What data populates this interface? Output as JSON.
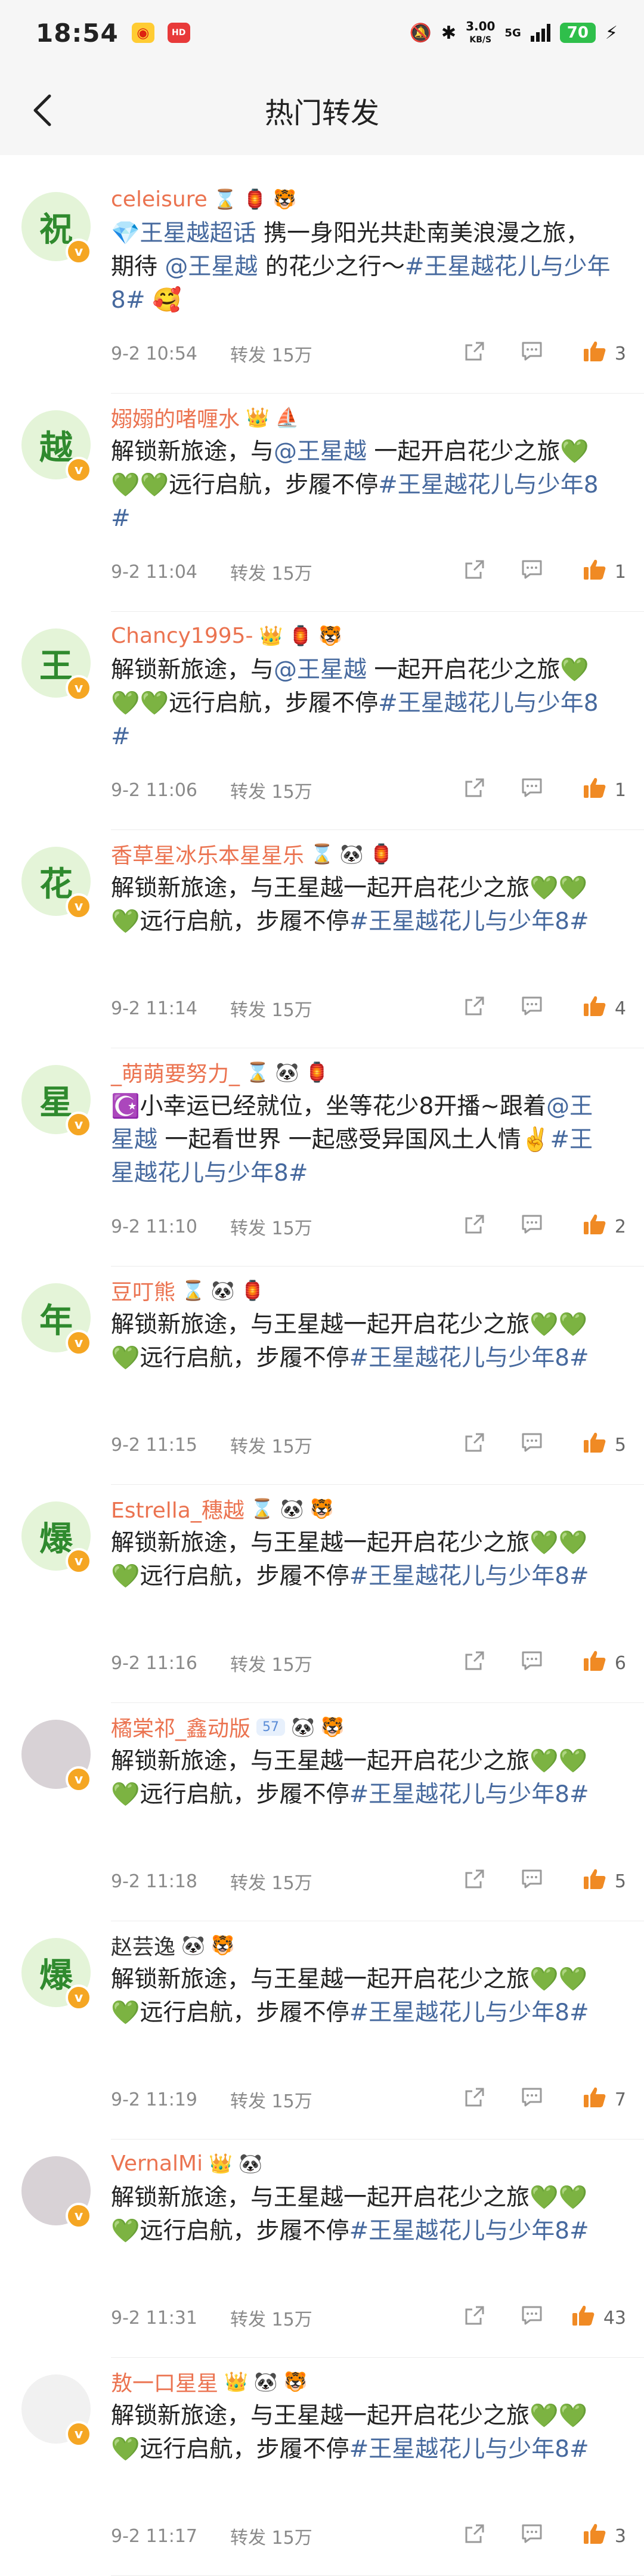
{
  "status_bar": {
    "time": "18:54",
    "net_speed_value": "3.00",
    "net_speed_unit": "KB/S",
    "network": "5G",
    "battery": "70"
  },
  "header": {
    "title": "热门转发"
  },
  "repost_label": "转发",
  "comments": [
    {
      "avatar_char": "祝",
      "username": "celeisure",
      "badges": [
        "⌛",
        "🏮",
        "🐯"
      ],
      "segments": [
        {
          "t": "💎王星越超话",
          "link": true
        },
        {
          "t": " 携一身阳光共赴南美浪漫之旅，期待 "
        },
        {
          "t": "@王星越",
          "link": true
        },
        {
          "t": " 的花少之行～"
        },
        {
          "t": "#王星越花儿与少年8#",
          "link": true
        },
        {
          "t": " 🥰"
        }
      ],
      "time": "9-2 10:54",
      "reposts": "15万",
      "likes": "3"
    },
    {
      "avatar_char": "越",
      "username": "嫋嫋的啫喱水",
      "badges": [
        "👑",
        "⛵"
      ],
      "segments": [
        {
          "t": "解锁新旅途，与"
        },
        {
          "t": "@王星越",
          "link": true
        },
        {
          "t": " 一起开启花少之旅💚💚💚远行启航，步履不停"
        },
        {
          "t": "#王星越花儿与少年8#",
          "link": true
        }
      ],
      "time": "9-2 11:04",
      "reposts": "15万",
      "likes": "1"
    },
    {
      "avatar_char": "王",
      "username": "Chancy1995-",
      "badges": [
        "👑",
        "🏮",
        "🐯"
      ],
      "segments": [
        {
          "t": "解锁新旅途，与"
        },
        {
          "t": "@王星越",
          "link": true
        },
        {
          "t": " 一起开启花少之旅💚💚💚远行启航，步履不停"
        },
        {
          "t": "#王星越花儿与少年8#",
          "link": true
        }
      ],
      "time": "9-2 11:06",
      "reposts": "15万",
      "likes": "1"
    },
    {
      "avatar_char": "花",
      "username": "香草星冰乐本星星乐",
      "badges": [
        "⌛",
        "🐼",
        "🏮"
      ],
      "segments": [
        {
          "t": "解锁新旅途，与王星越一起开启花少之旅💚💚💚远行启航，步履不停"
        },
        {
          "t": "#王星越花儿与少年8#",
          "link": true
        }
      ],
      "time": "9-2 11:14",
      "reposts": "15万",
      "likes": "4"
    },
    {
      "avatar_char": "星",
      "username": "_萌萌要努力_",
      "badges": [
        "⌛",
        "🐼",
        "🏮"
      ],
      "segments": [
        {
          "t": "☪️小幸运已经就位，坐等花少8开播~跟着"
        },
        {
          "t": "@王星越",
          "link": true
        },
        {
          "t": " 一起看世界 一起感受异国风土人情✌️"
        },
        {
          "t": "#王星越花儿与少年8#",
          "link": true
        }
      ],
      "time": "9-2 11:10",
      "reposts": "15万",
      "likes": "2"
    },
    {
      "avatar_char": "年",
      "username": "豆叮熊",
      "badges": [
        "⌛",
        "🐼",
        "🏮"
      ],
      "segments": [
        {
          "t": "解锁新旅途，与王星越一起开启花少之旅💚💚💚远行启航，步履不停"
        },
        {
          "t": "#王星越花儿与少年8#",
          "link": true
        }
      ],
      "time": "9-2 11:15",
      "reposts": "15万",
      "likes": "5"
    },
    {
      "avatar_char": "爆",
      "username": "Estrella_穗越",
      "badges": [
        "⌛",
        "🐼",
        "🐯"
      ],
      "segments": [
        {
          "t": "解锁新旅途，与王星越一起开启花少之旅💚💚💚远行启航，步履不停"
        },
        {
          "t": "#王星越花儿与少年8#",
          "link": true
        }
      ],
      "time": "9-2 11:16",
      "reposts": "15万",
      "likes": "6"
    },
    {
      "avatar_char": "",
      "avatar_kind": "photo",
      "username": "橘棠祁_鑫动版",
      "vip": "57",
      "badges": [
        "🐼",
        "🐯"
      ],
      "segments": [
        {
          "t": "解锁新旅途，与王星越一起开启花少之旅💚💚💚远行启航，步履不停"
        },
        {
          "t": "#王星越花儿与少年8#",
          "link": true
        }
      ],
      "time": "9-2 11:18",
      "reposts": "15万",
      "likes": "5"
    },
    {
      "avatar_char": "爆",
      "username": "赵芸逸",
      "username_plain": true,
      "badges": [
        "🐼",
        "🐯"
      ],
      "segments": [
        {
          "t": "解锁新旅途，与王星越一起开启花少之旅💚💚💚远行启航，步履不停"
        },
        {
          "t": "#王星越花儿与少年8#",
          "link": true
        }
      ],
      "time": "9-2 11:19",
      "reposts": "15万",
      "likes": "7"
    },
    {
      "avatar_char": "",
      "avatar_kind": "photo",
      "username": "VernalMi",
      "badges": [
        "👑",
        "🐼"
      ],
      "segments": [
        {
          "t": "解锁新旅途，与王星越一起开启花少之旅💚💚💚远行启航，步履不停"
        },
        {
          "t": "#王星越花儿与少年8#",
          "link": true
        }
      ],
      "time": "9-2 11:31",
      "reposts": "15万",
      "likes": "43"
    },
    {
      "avatar_char": "",
      "avatar_kind": "sketch",
      "username": "敖一口星星",
      "badges": [
        "👑",
        "🐼",
        "🐯"
      ],
      "segments": [
        {
          "t": "解锁新旅途，与王星越一起开启花少之旅💚💚💚远行启航，步履不停"
        },
        {
          "t": "#王星越花儿与少年8#",
          "link": true
        }
      ],
      "time": "9-2 11:17",
      "reposts": "15万",
      "likes": "3"
    }
  ]
}
